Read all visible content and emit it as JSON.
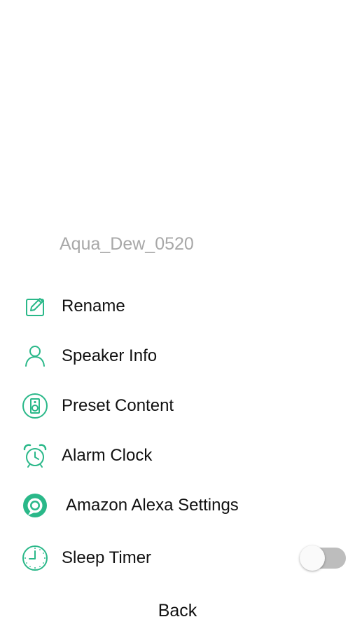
{
  "device": {
    "name": "Aqua_Dew_0520"
  },
  "menu": {
    "items": [
      {
        "label": "Rename",
        "icon": "edit-icon"
      },
      {
        "label": "Speaker Info",
        "icon": "person-icon"
      },
      {
        "label": "Preset Content",
        "icon": "speaker-icon"
      },
      {
        "label": "Alarm Clock",
        "icon": "alarm-clock-icon"
      },
      {
        "label": "Amazon Alexa Settings",
        "icon": "alexa-icon"
      },
      {
        "label": "Sleep Timer",
        "icon": "clock-icon",
        "toggle_on": false
      }
    ]
  },
  "footer": {
    "back_label": "Back"
  },
  "colors": {
    "accent": "#2ab889",
    "device_name": "#a8a8a8",
    "text": "#111111",
    "toggle_off_track": "#bdbdbd"
  }
}
